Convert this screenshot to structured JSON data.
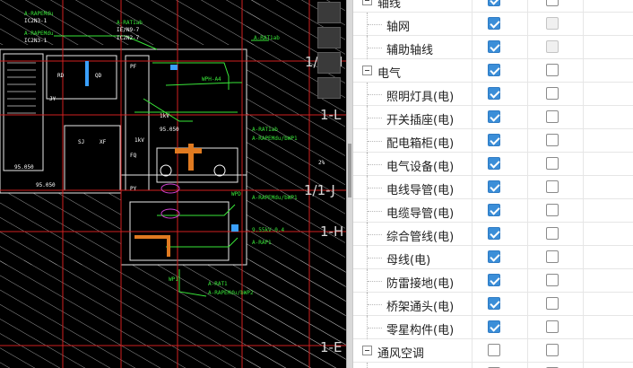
{
  "layer_panel": {
    "rows": [
      {
        "label": "轴线",
        "type": "group",
        "col1": "on",
        "col2": "off"
      },
      {
        "label": "轴网",
        "type": "child",
        "col1": "on",
        "col2": "disabled"
      },
      {
        "label": "辅助轴线",
        "type": "child",
        "col1": "on",
        "col2": "disabled"
      },
      {
        "label": "电气",
        "type": "group",
        "col1": "on",
        "col2": "off"
      },
      {
        "label": "照明灯具(电)",
        "type": "child",
        "col1": "on",
        "col2": "off"
      },
      {
        "label": "开关插座(电)",
        "type": "child",
        "col1": "on",
        "col2": "off"
      },
      {
        "label": "配电箱柜(电)",
        "type": "child",
        "col1": "on",
        "col2": "off"
      },
      {
        "label": "电气设备(电)",
        "type": "child",
        "col1": "on",
        "col2": "off"
      },
      {
        "label": "电线导管(电)",
        "type": "child",
        "col1": "on",
        "col2": "off"
      },
      {
        "label": "电缆导管(电)",
        "type": "child",
        "col1": "on",
        "col2": "off"
      },
      {
        "label": "综合管线(电)",
        "type": "child",
        "col1": "on",
        "col2": "off"
      },
      {
        "label": "母线(电)",
        "type": "child",
        "col1": "on",
        "col2": "off"
      },
      {
        "label": "防雷接地(电)",
        "type": "child",
        "col1": "on",
        "col2": "off"
      },
      {
        "label": "桥架通头(电)",
        "type": "child",
        "col1": "on",
        "col2": "off"
      },
      {
        "label": "零星构件(电)",
        "type": "child",
        "col1": "on",
        "col2": "off"
      },
      {
        "label": "通风空调",
        "type": "group",
        "col1": "off",
        "col2": "off"
      },
      {
        "label": "",
        "type": "child",
        "col1": "off",
        "col2": "off"
      }
    ]
  },
  "cad": {
    "axis_labels": [
      "1/1-M",
      "1-L",
      "1/1-J",
      "1-H",
      "1-E"
    ],
    "room_labels": [
      "RD",
      "QD",
      "PF",
      "FQ",
      "SJ",
      "XF",
      "PY",
      "JY"
    ],
    "annotations": [
      "A-RAPEMdu",
      "IC2N3-1",
      "A-RAPEMdu",
      "IC2N3-1",
      "A-RAT1ab",
      "IE/N9-7",
      "IC2N2-7",
      "A-RAT1ab",
      "WPH-A4",
      "95.050",
      "A-RAT1ab",
      "A-RAPEMdu/bWP1",
      "1kV",
      "95.050",
      "A-RAPEMdu/bWP1",
      "9.55kV-0.4",
      "A-RAP1",
      "WP1",
      "A-RAT1",
      "A-RAPEMdu/bWP2",
      "WPD",
      "2%",
      "95.050",
      "1kV"
    ],
    "toolbar_icons": [
      "nav-cube-icon",
      "orbit-icon",
      "zoom-icon",
      "pan-icon"
    ]
  }
}
